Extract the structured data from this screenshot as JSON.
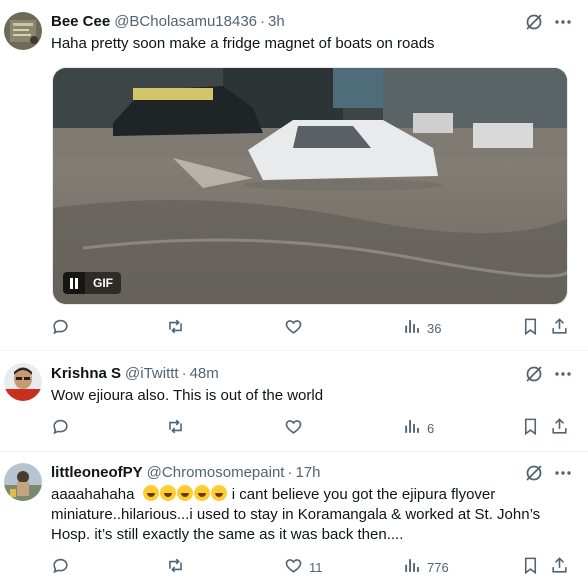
{
  "tweets": [
    {
      "name": "Bee Cee",
      "handle": "@BCholasamu18436",
      "time": "3h",
      "text": "Haha pretty soon make a fridge magnet of boats on roads",
      "gif_label": "GIF",
      "views": "36",
      "likes": "",
      "reposts": "",
      "replies": ""
    },
    {
      "name": "Krishna S",
      "handle": "@iTwittt",
      "time": "48m",
      "text": "Wow ejioura also. This is out of the world",
      "views": "6",
      "likes": "",
      "reposts": "",
      "replies": ""
    },
    {
      "name": "littleoneofPY",
      "handle": "@Chromosomepaint",
      "time": "17h",
      "text_prefix": "aaaahahaha",
      "emoji_count": 5,
      "text_line1_suffix": " i cant believe you got the ejipura flyover",
      "text_line2": "miniature..hilarious...i used to stay in Koramangala & worked at St. John’s",
      "text_line3": "Hosp. it’s still exactly the same as it was back then....",
      "views": "776",
      "likes": "11",
      "reposts": "",
      "replies": ""
    }
  ],
  "separator": "·",
  "colors": {
    "text": "#0f1419",
    "muted": "#536471",
    "divider": "#eff3f4"
  },
  "icons": [
    "reply-icon",
    "repost-icon",
    "like-icon",
    "views-icon",
    "bookmark-icon",
    "share-icon",
    "grok-icon",
    "more-icon",
    "pause-icon"
  ]
}
